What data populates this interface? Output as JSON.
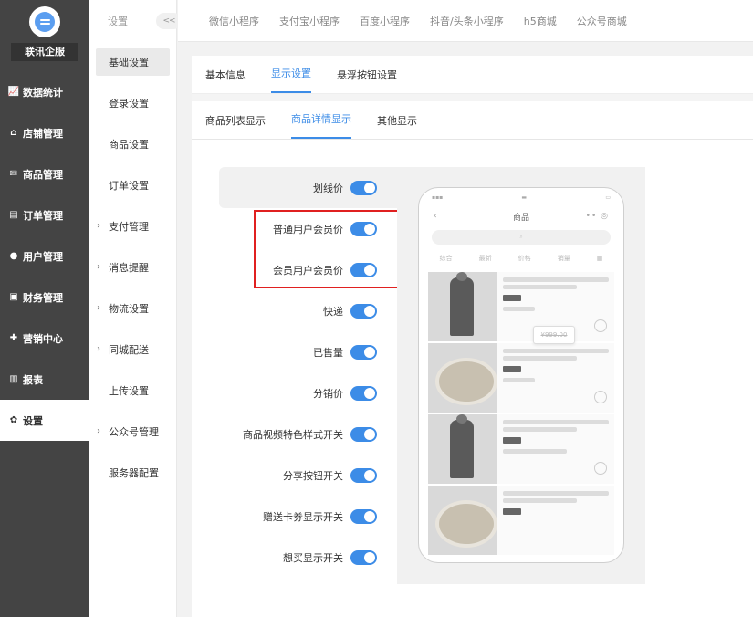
{
  "brand": {
    "name": "联讯企服"
  },
  "sidebar": {
    "items": [
      {
        "label": "数据统计",
        "icon": "chart-icon"
      },
      {
        "label": "店铺管理",
        "icon": "store-icon"
      },
      {
        "label": "商品管理",
        "icon": "goods-icon"
      },
      {
        "label": "订单管理",
        "icon": "order-icon"
      },
      {
        "label": "用户管理",
        "icon": "user-icon"
      },
      {
        "label": "财务管理",
        "icon": "finance-icon"
      },
      {
        "label": "营销中心",
        "icon": "marketing-icon"
      },
      {
        "label": "报表",
        "icon": "report-icon"
      },
      {
        "label": "设置",
        "icon": "gear-icon",
        "active": true
      }
    ]
  },
  "subnav": {
    "title": "设置",
    "collapse": "<<",
    "items": [
      {
        "label": "基础设置",
        "active": true
      },
      {
        "label": "登录设置"
      },
      {
        "label": "商品设置"
      },
      {
        "label": "订单设置"
      },
      {
        "label": "支付管理",
        "expandable": true
      },
      {
        "label": "消息提醒",
        "expandable": true
      },
      {
        "label": "物流设置",
        "expandable": true
      },
      {
        "label": "同城配送",
        "expandable": true
      },
      {
        "label": "上传设置"
      },
      {
        "label": "公众号管理",
        "expandable": true
      },
      {
        "label": "服务器配置"
      }
    ]
  },
  "topbar": {
    "tabs": [
      "微信小程序",
      "支付宝小程序",
      "百度小程序",
      "抖音/头条小程序",
      "h5商城",
      "公众号商城"
    ]
  },
  "tabs_primary": [
    {
      "label": "基本信息"
    },
    {
      "label": "显示设置",
      "active": true
    },
    {
      "label": "悬浮按钮设置"
    }
  ],
  "tabs_secondary": [
    {
      "label": "商品列表显示"
    },
    {
      "label": "商品详情显示",
      "active": true
    },
    {
      "label": "其他显示"
    }
  ],
  "settings": [
    {
      "label": "划线价",
      "on": true
    },
    {
      "label": "普通用户会员价",
      "on": true
    },
    {
      "label": "会员用户会员价",
      "on": true
    },
    {
      "label": "快递",
      "on": true
    },
    {
      "label": "已售量",
      "on": true
    },
    {
      "label": "分销价",
      "on": true
    },
    {
      "label": "商品视频特色样式开关",
      "on": true
    },
    {
      "label": "分享按钮开关",
      "on": true
    },
    {
      "label": "赠送卡券显示开关",
      "on": true
    },
    {
      "label": "想买显示开关",
      "on": true
    }
  ],
  "phone": {
    "title": "商品",
    "strike_price": "¥999.00",
    "filters": [
      "综合",
      "最新",
      "价格",
      "销量"
    ]
  },
  "colors": {
    "accent": "#3c8ce7",
    "sidebar": "#444444",
    "highlight_box": "#e02020"
  }
}
